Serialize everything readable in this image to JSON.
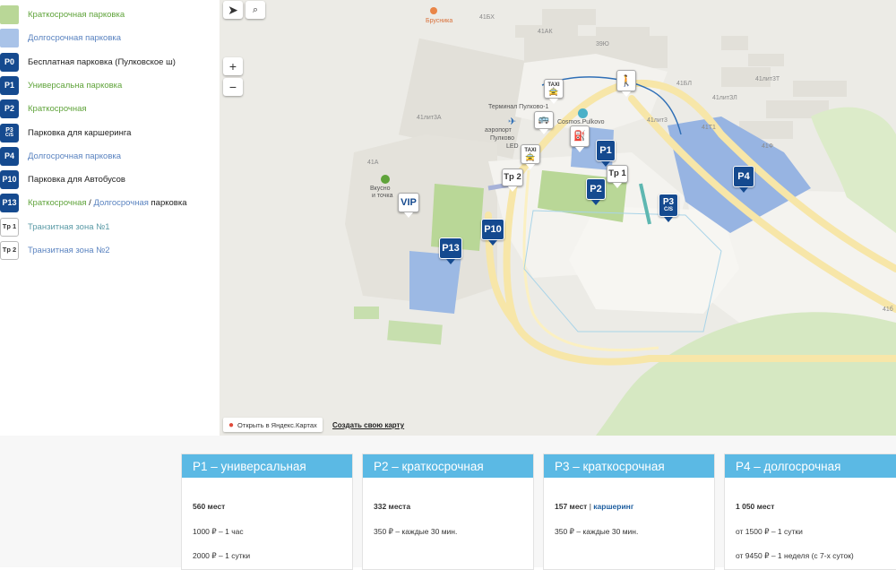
{
  "legend": {
    "items": [
      {
        "kind": "swatch",
        "color": "#b9d797",
        "text": "Краткосрочная парковка",
        "text_color": "#5fa33a"
      },
      {
        "kind": "swatch",
        "color": "#a9c3e8",
        "text": "Долгосрочная парковка",
        "text_color": "#5a83c0"
      },
      {
        "kind": "badge",
        "badge": "P0",
        "text": "Бесплатная парковка (Пулковское ш)",
        "text_color": "#222222"
      },
      {
        "kind": "badge",
        "badge": "P1",
        "text": "Универсальна парковка",
        "text_color": "#5fa33a"
      },
      {
        "kind": "badge",
        "badge": "P2",
        "text": "Краткосрочная",
        "text_color": "#5fa33a"
      },
      {
        "kind": "badge2",
        "badge": "P3",
        "badge_sub": "C/S",
        "text": "Парковка для каршеринга",
        "text_color": "#222222"
      },
      {
        "kind": "badge",
        "badge": "P4",
        "text": "Долгосрочная парковка",
        "text_color": "#5a83c0"
      },
      {
        "kind": "badge",
        "badge": "P10",
        "text": "Парковка для Автобусов",
        "text_color": "#222222"
      },
      {
        "kind": "badge",
        "badge": "P13",
        "text_parts": [
          "Краткосрочная",
          " / ",
          "Долгосрочная",
          " парковка"
        ],
        "text_color": "#5fa33a"
      },
      {
        "kind": "badge-white",
        "badge": "Tp 1",
        "text": "Транзитная зона №1",
        "text_color": "#5a9aa6"
      },
      {
        "kind": "badge-white",
        "badge": "Tp 2",
        "text": "Транзитная зона №2",
        "text_color": "#5a83c0"
      }
    ]
  },
  "map": {
    "controls": {
      "locate_icon": "arrow-icon",
      "search_icon": "search-icon",
      "zoom_in": "+",
      "zoom_out": "−"
    },
    "pins": {
      "p1": "P1",
      "p2": "P2",
      "p3": "P3",
      "p3_sub": "C/S",
      "p4": "P4",
      "p10": "P10",
      "p13": "P13",
      "vip": "VIP",
      "tp1": "Tp 1",
      "tp2": "Tp 2",
      "taxi": "TAXI"
    },
    "labels": {
      "brusnika": "Брусника",
      "b41bkh": "41БХ",
      "b41ak": "41АК",
      "b39yu": "39Ю",
      "b41bl": "41БЛ",
      "b41litzl": "41литЗЛ",
      "b41lit3t": "41лит3Т",
      "b41lit3": "41лит3",
      "b41lit3a": "41лит3А",
      "b41t1": "41Т1",
      "b41f": "41Ф",
      "b41a": "41А",
      "terminal": "Терминал Пулково-1",
      "airport": "аэропорт",
      "pulkovo": "Пулково",
      "led": "LED",
      "cosmos": "Cosmos.Pulkovo",
      "vkusno": "Вкусно",
      "i_tochka": "и точка",
      "b41b": "41б"
    },
    "footer": {
      "open_in": "Открыть в Яндекс.Картах",
      "create": "Создать свою карту"
    }
  },
  "cards": [
    {
      "title": "P1 – универсальная",
      "capacity": "560 мест",
      "line1": "1000 ₽ – 1 час",
      "line2": "2000 ₽ – 1 сутки"
    },
    {
      "title": "P2 – краткосрочная",
      "capacity": "332 места",
      "line1": "350 ₽ – каждые 30 мин.",
      "line2": ""
    },
    {
      "title": "P3 – краткосрочная",
      "capacity": "157 мест",
      "capacity_sep": " | ",
      "capacity_link": "каршеринг",
      "line1": "350 ₽ – каждые 30 мин.",
      "line2": ""
    },
    {
      "title": "P4 – долгосрочная",
      "capacity": "1 050 мест",
      "line1": "от 1500 ₽ – 1 сутки",
      "line2": "от 9450 ₽ – 1 неделя (с 7-х суток)"
    }
  ],
  "colors": {
    "navy": "#154a8f",
    "card_header": "#5bb9e4",
    "short_term": "#b9d797",
    "long_term": "#a9c3e8"
  }
}
